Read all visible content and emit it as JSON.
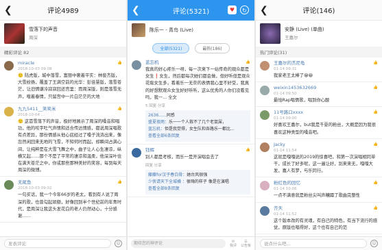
{
  "panel1": {
    "title": "评论4989",
    "song_name": "雪落下的声音",
    "song_artist": "周深",
    "section": "精彩评论",
    "section_count": "82",
    "comments": [
      {
        "user": "miracle",
        "time": "2018-10-03 09:08",
        "likes": "",
        "color": "#8a6a4a",
        "text": "🙂 陆虎版，城中落雪，富丽中裹着平实：林俊杰版，大雪纷扬，覆盖了王满空前的光华：彭佳慧版，落雪苍茫，让旧情谦冷寂寂回还宫里：而周深版，则是落雪无声，喧着春情，只留宫中一片白茫茫的大地"
      },
      {
        "user": "九九5411__笑笑米",
        "time": "2018-10-04 ...",
        "likes": "",
        "color": "#d9b24a",
        "text": "🙂 这首雪落下的声音，极好地展示了周深的嗓音和唱功，他的咬字吐气声情和适合传达情感，都说周深唱歌有点差异，那份情感从他心底经过了嗓子流淌出来，像忽然闲回来无地的飞雪，不知何时而起，却瞬间占满心间，让纯粹是在大雪飞舞之中，曲子让人心生凄凉，纵横又起……那个不是了平常的凄凉和温柔，他深深叶住在满天苍茫之中，你或那些那种美好的笑容，每到每天周深的微博。"
      },
      {
        "user": "无尾鱼",
        "time": "2018-10-03 09:02",
        "likes": "",
        "color": "#6a8a5a",
        "text": "一句买话，我一个今年66岁的老太，看到有人说了周深的歌，也曾勾起顽额，好像回到半个世纪前的年青时代，是周深让我这头发花白的老人仍然动心，十分感谢……"
      }
    ],
    "input_placeholder": "发表评论"
  },
  "panel2": {
    "title": "评论(5321)",
    "song_name": "陈乐一 - 青鸟 (Live)",
    "tab_all": "全部(5321)",
    "tab_hot": "最热(186)",
    "comments": [
      {
        "user": "蓝忘机",
        "time": "2018-10-04",
        "likes": "",
        "color": "#7a8fa0",
        "text": "我真的好心疼乐一呀，每一次来下一站传奇的观众都是女生❗女生，然后都每次她们都会做，但好听但是观众花痴女生多，看着乐一无奈的表情我心里不好受，我真的好想默观众女生好好听听，这么优秀的人你们没看见吗，我一... 全文",
        "actions": "5 回复·分享",
        "replies": [
          {
            "name": "2636......",
            "text": "同感"
          },
          {
            "name": "盛夏夜雨：",
            "text": "乐一一个人救不了几个老鼠屎，"
          },
          {
            "name": "蓝忘机：",
            "text": "但是我觉得，女生队和各路乐一都比..."
          }
        ],
        "more": "查看全部6条回复"
      },
      {
        "user": "钰辉",
        "time": "2018-10-04",
        "likes": "",
        "color": "#3a6aa0",
        "text": "别人都是考核，而乐一是开演唱会去了",
        "actions": "回复·分享",
        "replies": [
          {
            "name": "藤藤for汉子春白骨：",
            "text": "她台风很强"
          },
          {
            "name": "少侠请天下全城横 ：",
            "text": "很嗨的样子 像是在演唱"
          }
        ],
        "more": "查看全部8条回复"
      }
    ],
    "input_placeholder": "期待您的神评论",
    "icon_comment": "我评",
    "icon_share": "公告板"
  },
  "panel3": {
    "title": "评论(146)",
    "song_name": "安静 (Live) (单曲)",
    "song_artist": "王嘉尔",
    "section": "热门评论(31)",
    "comments": [
      {
        "user": "王嘉尔的杰尼龟",
        "time": "01-14 09:31",
        "likes": "",
        "color": "#c09070",
        "text": "我家老王太棒了😀😀"
      },
      {
        "user": "weixin1453632669",
        "time": "01-14 09:50",
        "likes": "",
        "color": "#9aa",
        "text": "最怕Rap唱情歌，唱到你心酸"
      },
      {
        "user": "11号路口xxxx",
        "time": "01-14 09:00",
        "likes": "",
        "color": "#7a9a6a",
        "text": "好喜欢王嘉尔，but我是千耍的粉丝，大概是因为我很喜欢这种类型的嗓音吧。"
      },
      {
        "user": "Jacky",
        "time": "01-14 11:54",
        "likes": "",
        "color": "#b08060",
        "text": "这就是嘎嘎说的2019的惊喜吧，和第一次演唱相同单干，成长了好多呢，这一遍让好，别来来无，嘎嘎大发，嘉人有梦，与乐同行。"
      },
      {
        "user": "粉红色的回忆",
        "time": "01-14 10:06",
        "likes": "",
        "color": "#d8b0c0",
        "text": "一点不满意就是粉丝尖叫声糟蹋了歌曲完整性"
      },
      {
        "user": "齐天",
        "time": "01-14 11:52",
        "likes": "",
        "color": "#5a7aa0",
        "text": "这个版本改的有灵魂，有自己的特色，有当下流行的感觉，原版也唱得好，这个也有自己的范"
      }
    ],
    "input_placeholder": "说点什么吧..."
  }
}
